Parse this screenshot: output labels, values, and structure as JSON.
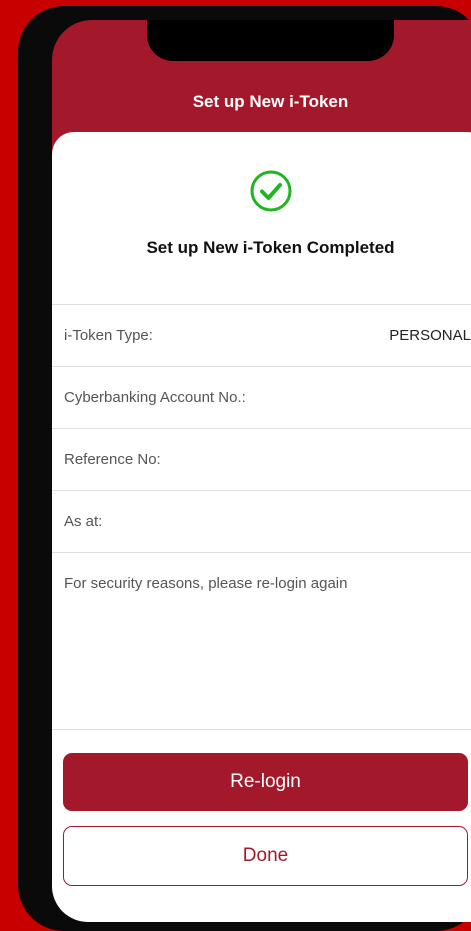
{
  "header": {
    "title": "Set up New i-Token"
  },
  "status": {
    "title": "Set up New i-Token Completed",
    "icon": "check-circle-icon",
    "icon_color": "#22b522"
  },
  "details": [
    {
      "label": "i-Token Type:",
      "value": "PERSONAL"
    },
    {
      "label": "Cyberbanking Account No.:",
      "value": ""
    },
    {
      "label": "Reference No:",
      "value": ""
    },
    {
      "label": "As at:",
      "value": ""
    }
  ],
  "notice": "For security reasons, please re-login again",
  "buttons": {
    "relogin": "Re-login",
    "done": "Done"
  },
  "colors": {
    "brand": "#a3192b",
    "background": "#c80000"
  }
}
